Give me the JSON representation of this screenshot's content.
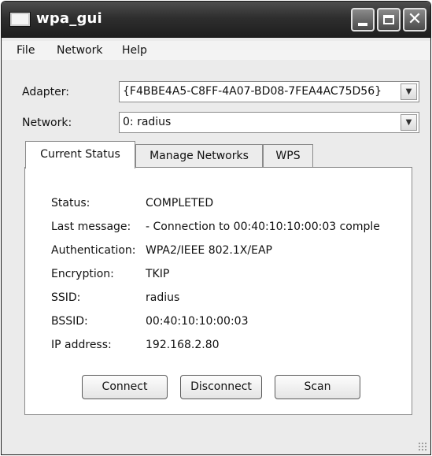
{
  "window": {
    "title": "wpa_gui",
    "minimize_glyph": "",
    "maximize_glyph": "",
    "close_glyph": "✕"
  },
  "menu": {
    "file": "File",
    "network": "Network",
    "help": "Help"
  },
  "adapter": {
    "label": "Adapter:",
    "value": "{F4BBE4A5-C8FF-4A07-BD08-7FEA4AC75D56}"
  },
  "network": {
    "label": "Network:",
    "value": "0: radius"
  },
  "tabs": [
    {
      "label": "Current Status",
      "active": true
    },
    {
      "label": "Manage Networks",
      "active": false
    },
    {
      "label": "WPS",
      "active": false
    }
  ],
  "status": {
    "rows": [
      {
        "label": "Status:",
        "value": "COMPLETED"
      },
      {
        "label": "Last message:",
        "value": "- Connection to 00:40:10:10:00:03 comple"
      },
      {
        "label": "Authentication:",
        "value": "WPA2/IEEE 802.1X/EAP"
      },
      {
        "label": "Encryption:",
        "value": "TKIP"
      },
      {
        "label": "SSID:",
        "value": "radius"
      },
      {
        "label": "BSSID:",
        "value": "00:40:10:10:00:03"
      },
      {
        "label": "IP address:",
        "value": "192.168.2.80"
      }
    ]
  },
  "buttons": {
    "connect": "Connect",
    "disconnect": "Disconnect",
    "scan": "Scan"
  },
  "icons": {
    "combo_arrow": "chevron-down-icon"
  }
}
